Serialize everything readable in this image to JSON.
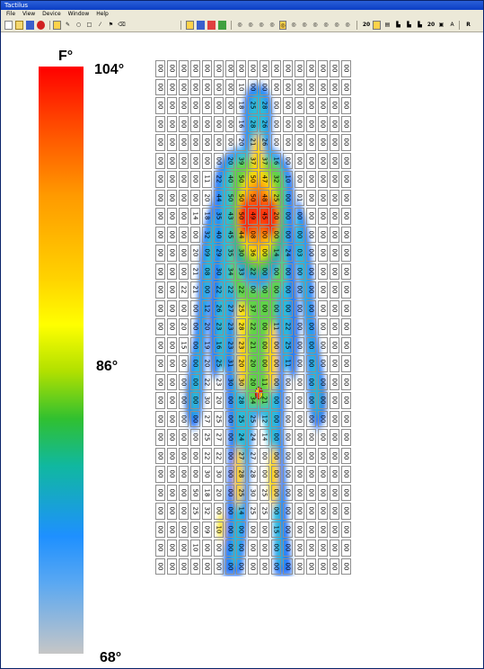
{
  "window": {
    "title": "Tactilus"
  },
  "menu": [
    "File",
    "View",
    "Device",
    "Window",
    "Help"
  ],
  "toolbar": {
    "mode_20": "20",
    "mode_20b": "20",
    "letter_a": "A",
    "letter_r": "R"
  },
  "scale": {
    "unit": "F°",
    "max": "104°",
    "mid": "86°",
    "min": "68°"
  },
  "grid": {
    "rows": [
      [
        "00",
        "00",
        "00",
        "00",
        "00",
        "00",
        "00",
        "00",
        "00",
        "00",
        "00",
        "00",
        "00",
        "00",
        "00",
        "00",
        "00"
      ],
      [
        "00",
        "00",
        "00",
        "00",
        "00",
        "00",
        "00",
        "10",
        "00",
        "00",
        "00",
        "00",
        "00",
        "00",
        "00",
        "00",
        "00"
      ],
      [
        "00",
        "00",
        "00",
        "00",
        "00",
        "00",
        "00",
        "18",
        "25",
        "28",
        "00",
        "00",
        "00",
        "00",
        "00",
        "00",
        "00"
      ],
      [
        "00",
        "00",
        "00",
        "00",
        "00",
        "00",
        "00",
        "16",
        "28",
        "26",
        "00",
        "00",
        "00",
        "00",
        "00",
        "00",
        "00"
      ],
      [
        "00",
        "00",
        "00",
        "00",
        "00",
        "00",
        "00",
        "20",
        "21",
        "26",
        "00",
        "00",
        "00",
        "00",
        "00",
        "00",
        "00"
      ],
      [
        "00",
        "00",
        "00",
        "00",
        "00",
        "00",
        "20",
        "39",
        "37",
        "37",
        "16",
        "00",
        "00",
        "00",
        "00",
        "00",
        "00"
      ],
      [
        "00",
        "00",
        "00",
        "00",
        "11",
        "22",
        "40",
        "50",
        "50",
        "47",
        "32",
        "10",
        "00",
        "00",
        "00",
        "00",
        "00"
      ],
      [
        "00",
        "00",
        "00",
        "00",
        "20",
        "44",
        "50",
        "50",
        "50",
        "48",
        "25",
        "00",
        "01",
        "00",
        "00",
        "00",
        "00"
      ],
      [
        "00",
        "00",
        "00",
        "14",
        "18",
        "35",
        "43",
        "50",
        "49",
        "45",
        "20",
        "00",
        "00",
        "00",
        "00",
        "00",
        "00"
      ],
      [
        "00",
        "00",
        "00",
        "00",
        "32",
        "40",
        "45",
        "44",
        "08",
        "00",
        "00",
        "00",
        "00",
        "00",
        "00",
        "00",
        "00"
      ],
      [
        "00",
        "00",
        "00",
        "20",
        "09",
        "29",
        "35",
        "30",
        "36",
        "00",
        "14",
        "24",
        "03",
        "00",
        "00",
        "00",
        "00"
      ],
      [
        "00",
        "00",
        "00",
        "21",
        "08",
        "30",
        "34",
        "33",
        "22",
        "00",
        "00",
        "00",
        "00",
        "00",
        "00",
        "00",
        "00"
      ],
      [
        "00",
        "00",
        "22",
        "21",
        "00",
        "22",
        "22",
        "22",
        "00",
        "00",
        "00",
        "00",
        "00",
        "00",
        "00",
        "00",
        "00"
      ],
      [
        "00",
        "00",
        "00",
        "00",
        "12",
        "26",
        "27",
        "25",
        "37",
        "00",
        "00",
        "00",
        "00",
        "00",
        "00",
        "00",
        "00"
      ],
      [
        "00",
        "00",
        "20",
        "00",
        "20",
        "23",
        "23",
        "28",
        "22",
        "00",
        "11",
        "22",
        "00",
        "00",
        "00",
        "00",
        "00"
      ],
      [
        "00",
        "00",
        "15",
        "00",
        "19",
        "16",
        "23",
        "23",
        "21",
        "00",
        "00",
        "25",
        "00",
        "00",
        "00",
        "00",
        "00"
      ],
      [
        "00",
        "00",
        "00",
        "00",
        "20",
        "25",
        "31",
        "20",
        "20",
        "00",
        "00",
        "11",
        "00",
        "00",
        "00",
        "00",
        "00"
      ],
      [
        "00",
        "00",
        "00",
        "00",
        "22",
        "23",
        "30",
        "30",
        "20",
        "11",
        "00",
        "00",
        "00",
        "00",
        "00",
        "00",
        "00"
      ],
      [
        "00",
        "00",
        "00",
        "00",
        "30",
        "20",
        "00",
        "28",
        "34",
        "21",
        "00",
        "00",
        "00",
        "00",
        "00",
        "00",
        "00"
      ],
      [
        "00",
        "00",
        "00",
        "00",
        "27",
        "25",
        "00",
        "25",
        "25",
        "12",
        "00",
        "00",
        "00",
        "00",
        "00",
        "00",
        "00"
      ],
      [
        "00",
        "00",
        "00",
        "00",
        "25",
        "27",
        "00",
        "24",
        "24",
        "14",
        "00",
        "00",
        "00",
        "00",
        "00",
        "00",
        "00"
      ],
      [
        "00",
        "00",
        "00",
        "00",
        "22",
        "22",
        "00",
        "27",
        "27",
        "00",
        "00",
        "00",
        "00",
        "00",
        "00",
        "00",
        "00"
      ],
      [
        "00",
        "00",
        "00",
        "00",
        "30",
        "30",
        "00",
        "28",
        "28",
        "00",
        "00",
        "00",
        "00",
        "00",
        "00",
        "00",
        "00"
      ],
      [
        "00",
        "00",
        "00",
        "50",
        "18",
        "20",
        "00",
        "25",
        "30",
        "25",
        "00",
        "00",
        "00",
        "00",
        "00",
        "00",
        "00"
      ],
      [
        "00",
        "00",
        "00",
        "25",
        "32",
        "00",
        "00",
        "14",
        "25",
        "25",
        "00",
        "00",
        "00",
        "00",
        "00",
        "00",
        "00"
      ],
      [
        "00",
        "00",
        "00",
        "00",
        "09",
        "10",
        "00",
        "00",
        "00",
        "00",
        "15",
        "00",
        "00",
        "00",
        "00",
        "00",
        "00"
      ],
      [
        "00",
        "00",
        "00",
        "10",
        "00",
        "00",
        "00",
        "00",
        "00",
        "00",
        "00",
        "00",
        "00",
        "00",
        "00",
        "00",
        "00"
      ],
      [
        "00",
        "00",
        "00",
        "00",
        "00",
        "00",
        "00",
        "00",
        "00",
        "00",
        "00",
        "00",
        "00",
        "00",
        "00",
        "00",
        "00"
      ]
    ]
  },
  "colors": {
    "accent_title": "#0b3ec4",
    "hot": "#ff0000",
    "cool": "#1e90ff"
  },
  "icons": [
    "new-file-icon",
    "open-icon",
    "save-icon",
    "stop-icon",
    "pointer-icon",
    "pen-icon",
    "ellipse-icon",
    "rect-icon",
    "line-icon",
    "grid-icon",
    "target-icon"
  ]
}
